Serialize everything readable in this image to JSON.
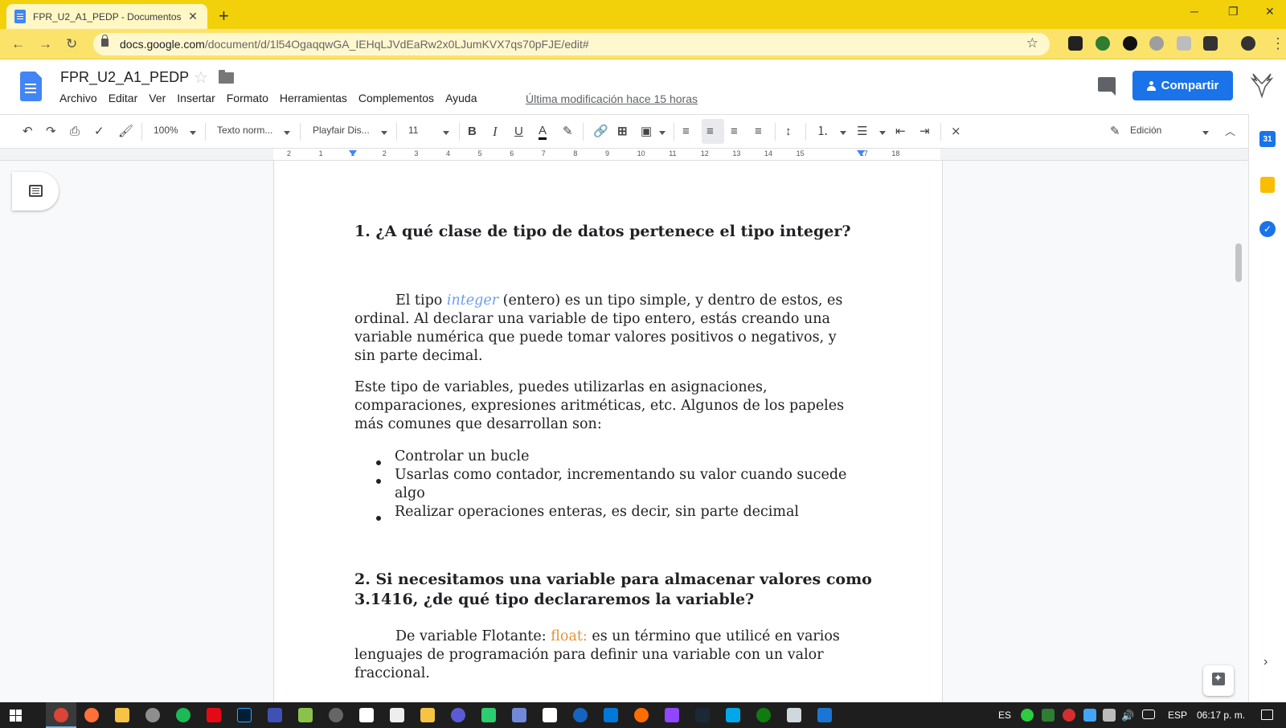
{
  "browser": {
    "tab_title": "FPR_U2_A1_PEDP - Documentos",
    "tab_close": "✕",
    "new_tab": "+",
    "url_host": "docs.google.com",
    "url_path": "/document/d/1l54OgaqqwGA_IEHqLJVdEaRw2x0LJumKVX7qs70pFJE/edit#",
    "window_controls": {
      "minimize": "─",
      "restore": "❐",
      "close": "✕"
    },
    "back": "←",
    "forward": "→",
    "reload": "↻",
    "bookmark": "☆",
    "menu": "⋮",
    "theme_color": "#f2d10b"
  },
  "docs": {
    "document_title": "FPR_U2_A1_PEDP",
    "menu": [
      "Archivo",
      "Editar",
      "Ver",
      "Insertar",
      "Formato",
      "Herramientas",
      "Complementos",
      "Ayuda"
    ],
    "last_edit": "Última modificación hace 15 horas",
    "share_label": "Compartir",
    "accent": "#1a73e8"
  },
  "toolbar": {
    "zoom": "100%",
    "style": "Texto norm...",
    "font": "Playfair Dis...",
    "size": "11",
    "bold": "B",
    "italic": "I",
    "underline": "U",
    "text_color": "A",
    "mode_label": "Edición"
  },
  "ruler": {
    "numbers": [
      "2",
      "1",
      "1",
      "2",
      "3",
      "4",
      "5",
      "6",
      "7",
      "8",
      "9",
      "10",
      "11",
      "12",
      "13",
      "14",
      "15",
      "17",
      "18"
    ]
  },
  "document": {
    "heading1": "1. ¿A qué clase de tipo de datos pertenece el tipo integer?",
    "p1_prefix": "El tipo ",
    "p1_keyword": "integer",
    "p1_suffix": " (entero) es un tipo simple, y dentro de estos, es",
    "p1_line2": "ordinal. Al declarar una variable de tipo entero, estás creando una",
    "p1_line3": "variable numérica que puede tomar valores positivos o negativos, y",
    "p1_line4": "sin parte decimal.",
    "p2_line1": "Este tipo de variables, puedes utilizarlas en asignaciones,",
    "p2_line2": "comparaciones, expresiones aritméticas, etc. Algunos de los papeles",
    "p2_line3": "más comunes que desarrollan son:",
    "bullets": [
      "Controlar un bucle",
      "Usarlas como contador, incrementando su valor cuando sucede",
      "Realizar operaciones enteras, es decir, sin parte decimal"
    ],
    "bullet2_cont": "algo",
    "heading2_line1": "2. Si necesitamos una variable para almacenar valores como",
    "heading2_line2": "3.1416, ¿de qué tipo declararemos la variable?",
    "p3_prefix": "De variable Flotante: ",
    "p3_keyword": "float:",
    "p3_suffix": " es un término que utilicé en varios",
    "p3_line2": "lenguajes de programación para definir una variable con un valor",
    "p3_line3": "fraccional."
  },
  "sidepanel": {
    "calendar": "31",
    "expand": "›"
  },
  "taskbar": {
    "lang1": "ES",
    "lang2": "ESP",
    "time": "06:17 p. m."
  }
}
